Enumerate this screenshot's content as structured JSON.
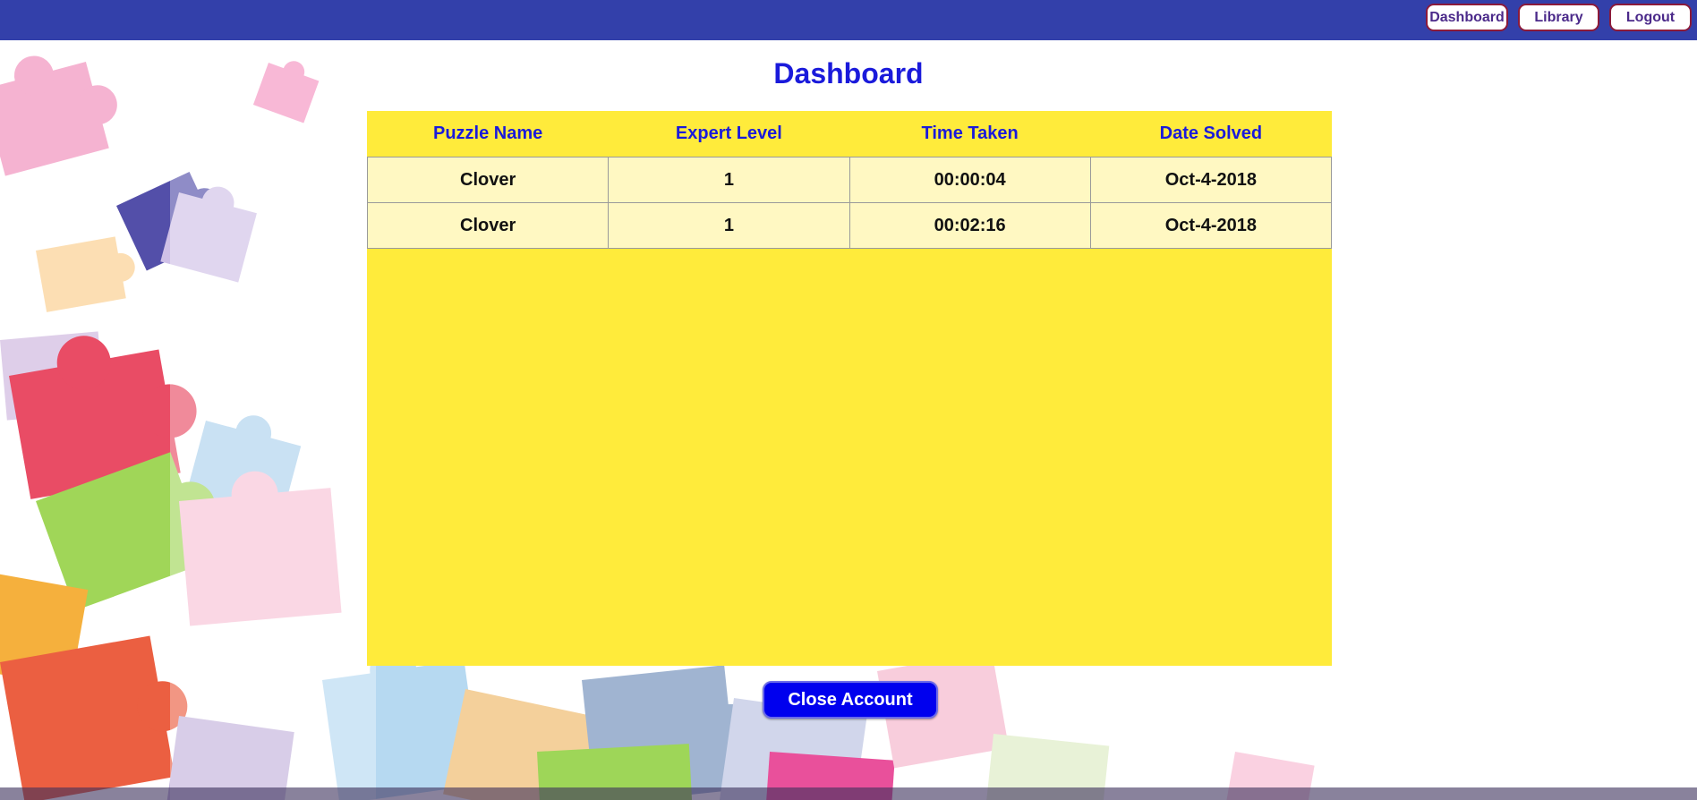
{
  "nav": {
    "dashboard_label": "Dashboard",
    "library_label": "Library",
    "logout_label": "Logout"
  },
  "page": {
    "title": "Dashboard"
  },
  "table": {
    "headers": [
      "Puzzle Name",
      "Expert Level",
      "Time Taken",
      "Date Solved"
    ],
    "rows": [
      [
        "Clover",
        "1",
        "00:00:04",
        "Oct-4-2018"
      ],
      [
        "Clover",
        "1",
        "00:02:16",
        "Oct-4-2018"
      ]
    ]
  },
  "actions": {
    "close_account_label": "Close Account"
  },
  "colors": {
    "nav_bar": "#3340aa",
    "title": "#1a1adb",
    "panel": "#ffeb3b",
    "row_background": "#fff8c2",
    "close_button": "#0000ee"
  }
}
